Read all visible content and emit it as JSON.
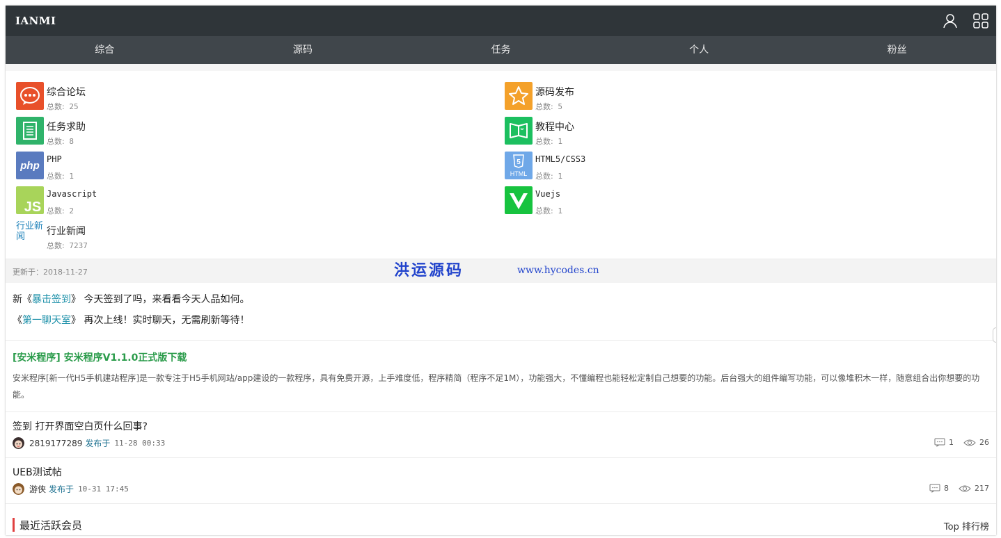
{
  "header": {
    "logo": "IANMI"
  },
  "nav": {
    "items": [
      "综合",
      "源码",
      "任务",
      "个人",
      "粉丝"
    ]
  },
  "forums": {
    "count_label": "总数:",
    "items": [
      {
        "name": "综合论坛",
        "count": "25",
        "icon": "chat-bubble-icon",
        "color": "#e8502a"
      },
      {
        "name": "源码发布",
        "count": "5",
        "icon": "star-icon",
        "color": "#f4a12a"
      },
      {
        "name": "任务求助",
        "count": "8",
        "icon": "document-icon",
        "color": "#2fb36a"
      },
      {
        "name": "教程中心",
        "count": "1",
        "icon": "book-icon",
        "color": "#1cbf5f"
      },
      {
        "name": "PHP",
        "count": "1",
        "icon": "php-logo-icon",
        "color": "#5a7bbf"
      },
      {
        "name": "HTML5/CSS3",
        "count": "1",
        "icon": "html5-logo-icon",
        "color": "#6fa8e8"
      },
      {
        "name": "Javascript",
        "count": "2",
        "icon": "js-logo-icon",
        "color": "#a8d45a"
      },
      {
        "name": "Vuejs",
        "count": "1",
        "icon": "vue-logo-icon",
        "color": "#17c33f"
      },
      {
        "name": "行业新闻",
        "count": "7237",
        "icon": "broken-image-icon",
        "alt": "行业新闻",
        "color": "#1a7fb8"
      }
    ]
  },
  "updated": {
    "label": "更新于：2018-11-27"
  },
  "watermark": {
    "cn": "洪运源码",
    "en": "www.hycodes.cn"
  },
  "notices": [
    {
      "prefix": "新《",
      "link": "暴击签到",
      "suffix": "》 今天签到了吗，来看看今天人品如何。"
    },
    {
      "prefix": "《",
      "link": "第一聊天室",
      "suffix": "》 再次上线！实时聊天，无需刷新等待！"
    }
  ],
  "article": {
    "title": "[安米程序] 安米程序V1.1.0正式版下载",
    "desc": "安米程序[新一代H5手机建站程序]是一款专注于H5手机网站/app建设的一款程序，具有免费开源，上手难度低，程序精简（程序不足1M），功能强大，不懂编程也能轻松定制自己想要的功能。后台强大的组件编写功能，可以像堆积木一样，随意组合出你想要的功能。"
  },
  "posts": [
    {
      "title": "签到 打开界面空白页什么回事?",
      "user": "2819177289",
      "pub": "发布于",
      "time": "11-28 00:33",
      "comments": "1",
      "views": "26"
    },
    {
      "title": "UEB测试帖",
      "user": "游侠",
      "pub": "发布于",
      "time": "10-31 17:45",
      "comments": "8",
      "views": "217"
    }
  ],
  "members": {
    "title": "最近活跃会员",
    "rank": "Top 排行榜"
  },
  "colors": {
    "topbar": "#2f3539",
    "nav": "#40464b",
    "link": "#1a8fa8",
    "article_title": "#2a9b4a",
    "accent_bar": "#e04040"
  }
}
